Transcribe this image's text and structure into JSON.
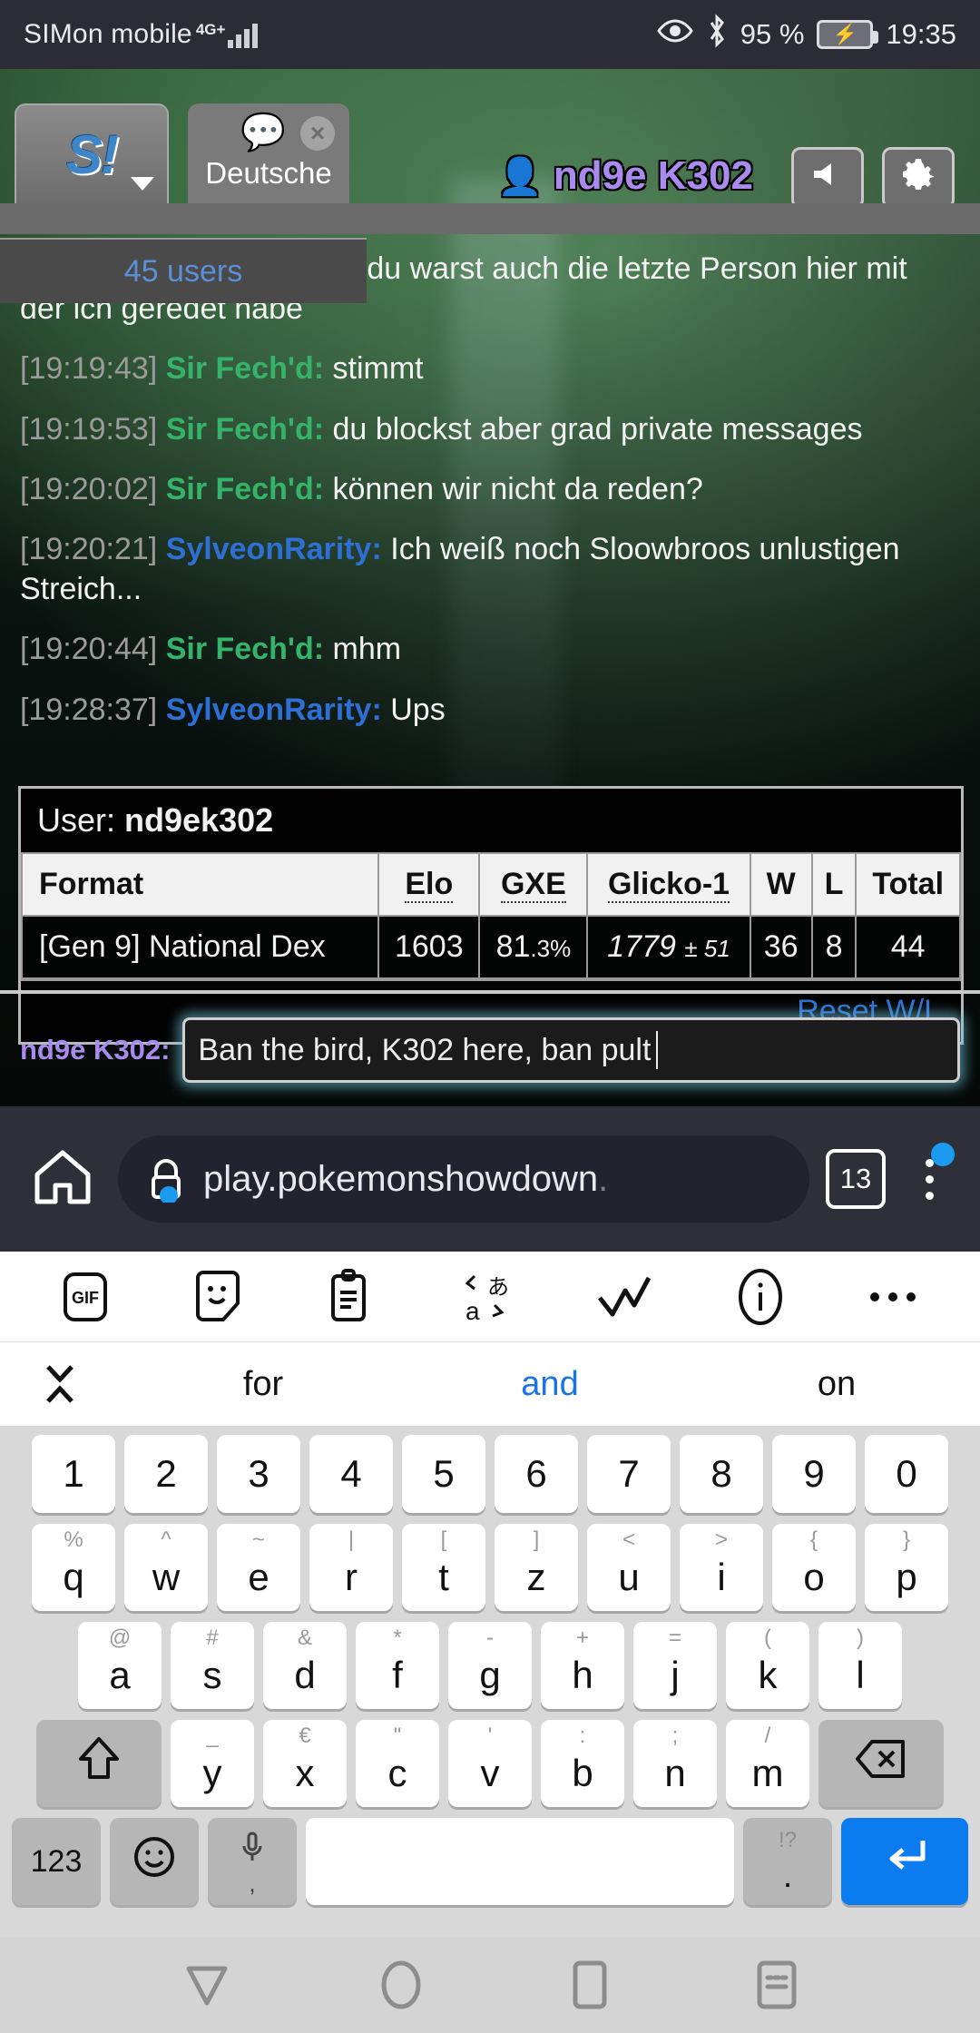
{
  "statusbar": {
    "carrier": "SIMon mobile",
    "network": "4G+",
    "battery_percent": "95 %",
    "time": "19:35",
    "icons": [
      "eye-icon",
      "bluetooth-icon",
      "battery-charging-icon"
    ]
  },
  "app": {
    "logo_text": "S!",
    "tab": {
      "label": "Deutsche",
      "icon": "chat-bubble-icon",
      "close": "×"
    },
    "username": "nd9e K302",
    "users_count": "45 users",
    "buttons": {
      "sound": "sound-icon",
      "settings": "gear-icon"
    },
    "chat": [
      {
        "ts": "",
        "name": "",
        "text": "Das ist gut ^^' ich glaube du warst auch die letzte Person hier mit der ich geredet habe",
        "color": "none"
      },
      {
        "ts": "[19:19:43]",
        "name": "Sir Fech'd:",
        "text": "stimmt",
        "color": "green"
      },
      {
        "ts": "[19:19:53]",
        "name": "Sir Fech'd:",
        "text": "du blockst aber grad private messages",
        "color": "green"
      },
      {
        "ts": "[19:20:02]",
        "name": "Sir Fech'd:",
        "text": "können wir nicht da reden?",
        "color": "green"
      },
      {
        "ts": "[19:20:21]",
        "name": "SylveonRarity:",
        "text": "Ich weiß noch Sloowbroos unlustigen Streich...",
        "color": "blue"
      },
      {
        "ts": "[19:20:44]",
        "name": "Sir Fech'd:",
        "text": "mhm",
        "color": "green"
      },
      {
        "ts": "[19:28:37]",
        "name": "SylveonRarity:",
        "text": "Ups",
        "color": "blue"
      }
    ],
    "ratings": {
      "user_label": "User:",
      "user_name": "nd9ek302",
      "headers": [
        "Format",
        "Elo",
        "GXE",
        "Glicko-1",
        "W",
        "L",
        "Total"
      ],
      "rows": [
        {
          "format": "[Gen 9] National Dex",
          "elo": "1603",
          "gxe_main": "81",
          "gxe_dec": ".3%",
          "glicko_main": "1779",
          "glicko_dev": "± 51",
          "w": "36",
          "l": "8",
          "total": "44"
        }
      ],
      "reset_link": "Reset W/L"
    },
    "input": {
      "name_prefix": "nd9e K302:",
      "value": "Ban the bird, K302 here, ban pult ",
      "placeholder": ""
    }
  },
  "browser": {
    "home_icon": "home-icon",
    "lock_icon": "lock-icon",
    "url": "play.pokemonshowdown",
    "url_truncated": ".",
    "tab_count": "13",
    "menu_icon": "kebab-menu-icon",
    "menu_badge": true
  },
  "keyboard": {
    "toolbar": [
      "gif-icon",
      "sticker-icon",
      "clipboard-icon",
      "translate-icon",
      "handwriting-icon",
      "info-icon",
      "more-icon"
    ],
    "toolbar_gif_label": "GIF",
    "suggestions": {
      "expand": "expand-chevrons-icon",
      "words": [
        "for",
        "and",
        "on"
      ],
      "highlighted_index": 1
    },
    "rows": {
      "numbers": [
        "1",
        "2",
        "3",
        "4",
        "5",
        "6",
        "7",
        "8",
        "9",
        "0"
      ],
      "row1": [
        {
          "sub": "%",
          "main": "q"
        },
        {
          "sub": "^",
          "main": "w"
        },
        {
          "sub": "~",
          "main": "e"
        },
        {
          "sub": "|",
          "main": "r"
        },
        {
          "sub": "[",
          "main": "t"
        },
        {
          "sub": "]",
          "main": "z"
        },
        {
          "sub": "<",
          "main": "u"
        },
        {
          "sub": ">",
          "main": "i"
        },
        {
          "sub": "{",
          "main": "o"
        },
        {
          "sub": "}",
          "main": "p"
        }
      ],
      "row2": [
        {
          "sub": "@",
          "main": "a"
        },
        {
          "sub": "#",
          "main": "s"
        },
        {
          "sub": "&",
          "main": "d"
        },
        {
          "sub": "*",
          "main": "f"
        },
        {
          "sub": "-",
          "main": "g"
        },
        {
          "sub": "+",
          "main": "h"
        },
        {
          "sub": "=",
          "main": "j"
        },
        {
          "sub": "(",
          "main": "k"
        },
        {
          "sub": ")",
          "main": "l"
        }
      ],
      "row3": [
        {
          "sub": "_",
          "main": "y"
        },
        {
          "sub": "€",
          "main": "x"
        },
        {
          "sub": "\"",
          "main": "c"
        },
        {
          "sub": "'",
          "main": "v"
        },
        {
          "sub": ":",
          "main": "b"
        },
        {
          "sub": ";",
          "main": "n"
        },
        {
          "sub": "/",
          "main": "m"
        }
      ],
      "shift_icon": "shift-icon",
      "backspace_icon": "backspace-icon",
      "numeric_label": "123",
      "emoji_icon": "emoji-icon",
      "mic_icon": "microphone-icon",
      "mic_sub": ",",
      "space_label": "",
      "period_sub": "!?",
      "period_main": ".",
      "enter_icon": "enter-icon"
    }
  },
  "navbar": {
    "back": "back-triangle-icon",
    "home": "home-circle-icon",
    "recents": "recents-square-icon",
    "keyboard": "hide-keyboard-icon"
  }
}
